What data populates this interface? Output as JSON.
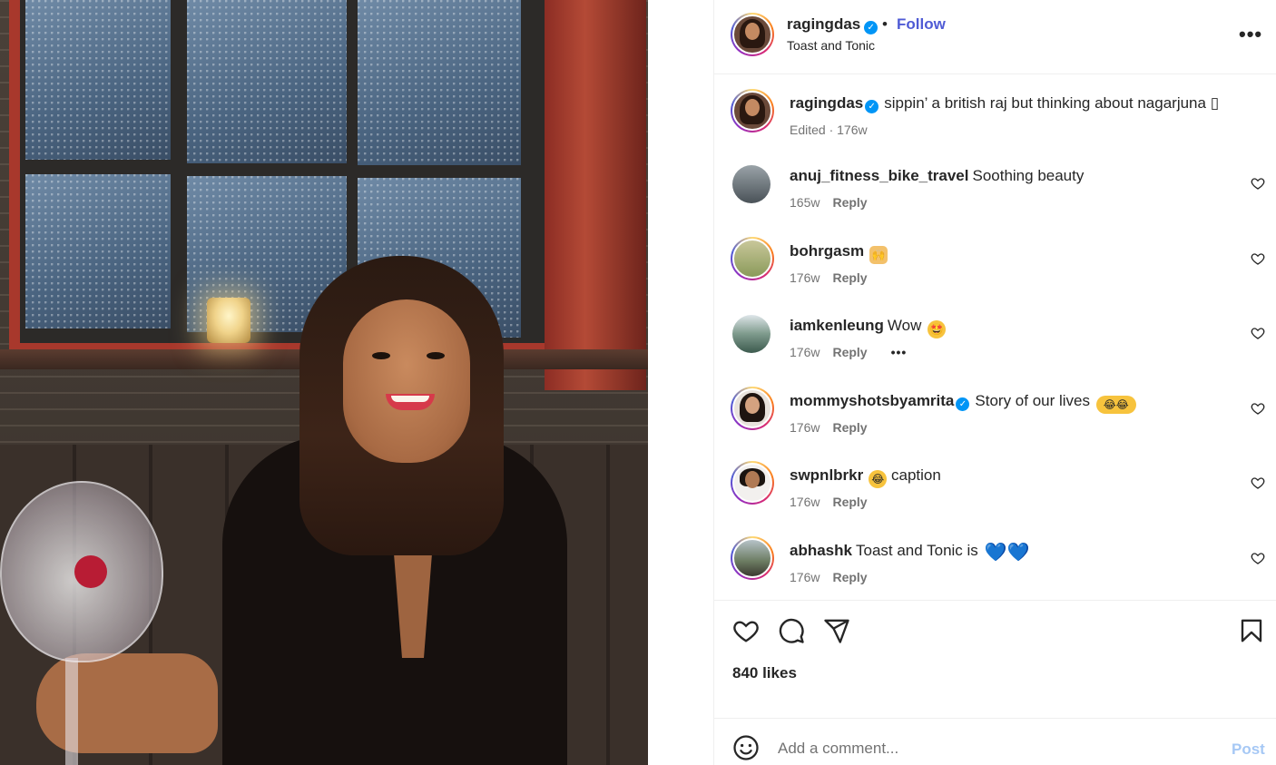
{
  "post": {
    "username": "ragingdas",
    "follow_label": "Follow",
    "separator": "•",
    "location": "Toast and Tonic",
    "more_label": "•••",
    "verified_mark": "✓"
  },
  "caption": {
    "username": "ragingdas",
    "text": "sippin’ a british raj but thinking about nagarjuna",
    "trailing_glyph": "▯",
    "meta": "Edited · 176w"
  },
  "comments": [
    {
      "username": "anuj_fitness_bike_travel",
      "text": "Soothing beauty",
      "age": "165w",
      "reply": "Reply"
    },
    {
      "username": "bohrgasm",
      "text": "",
      "emoji": "🙌",
      "age": "176w",
      "reply": "Reply"
    },
    {
      "username": "iamkenleung",
      "text": "Wow",
      "emoji": "🤩",
      "age": "176w",
      "reply": "Reply",
      "more": "•••"
    },
    {
      "username": "mommyshotsbyamrita",
      "text": "Story of our lives",
      "emoji": "😂😂",
      "age": "176w",
      "reply": "Reply"
    },
    {
      "username": "swpnlbrkr",
      "text": "caption",
      "emoji_before": "😂",
      "age": "176w",
      "reply": "Reply"
    },
    {
      "username": "abhashk",
      "text": "Toast and Tonic is",
      "emoji": "💙💙",
      "age": "176w",
      "reply": "Reply"
    }
  ],
  "likes": "840 likes",
  "add_comment": {
    "placeholder": "Add a comment...",
    "post_label": "Post"
  },
  "colors": {
    "link": "#4f5bd5",
    "verified": "#0095f6",
    "post_disabled": "#a6c8f5",
    "meta": "#737373"
  },
  "icons": [
    "more-icon",
    "verified-icon",
    "heart-icon",
    "comment-icon",
    "share-icon",
    "bookmark-icon",
    "emoji-icon"
  ]
}
